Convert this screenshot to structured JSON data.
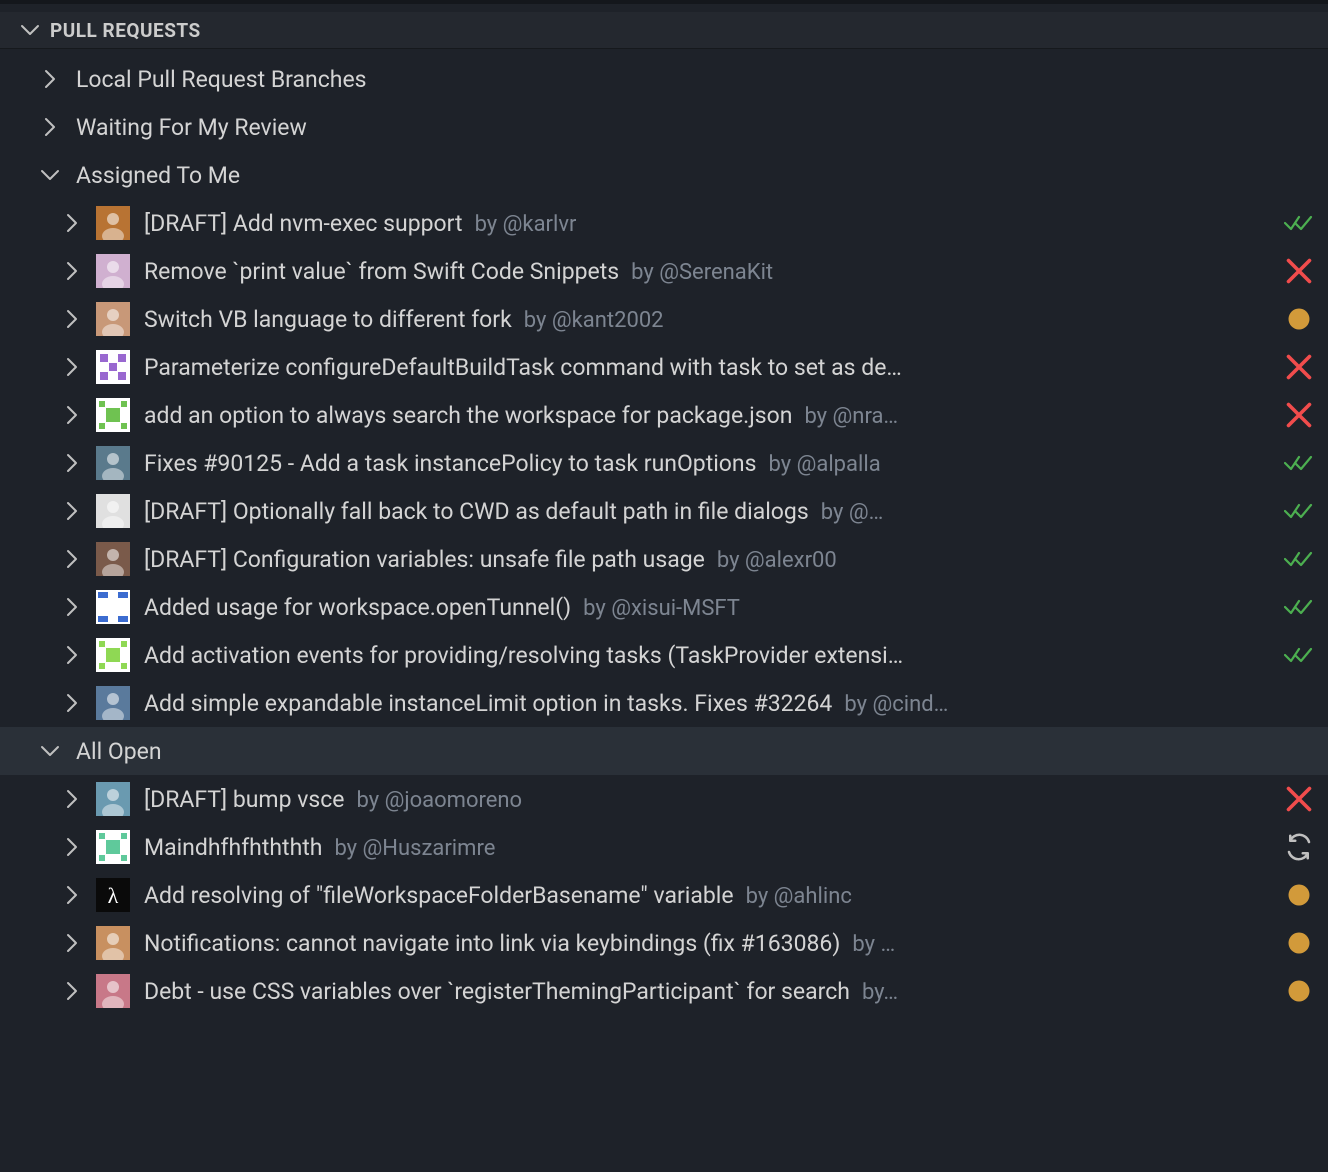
{
  "panel": {
    "title": "PULL REQUESTS"
  },
  "groups": [
    {
      "id": "local",
      "label": "Local Pull Request Branches",
      "expanded": false,
      "items": []
    },
    {
      "id": "waiting",
      "label": "Waiting For My Review",
      "expanded": false,
      "items": []
    },
    {
      "id": "assigned",
      "label": "Assigned To Me",
      "expanded": true,
      "items": [
        {
          "title": "[DRAFT] Add nvm-exec support",
          "author": "by @karlvr",
          "status": "success",
          "avatar": "av1"
        },
        {
          "title": "Remove `print value` from Swift Code Snippets",
          "author": "by @SerenaKit",
          "status": "fail",
          "avatar": "av2"
        },
        {
          "title": "Switch VB language to different fork",
          "author": "by @kant2002",
          "status": "pending",
          "avatar": "av3"
        },
        {
          "title": "Parameterize configureDefaultBuildTask command with task to set as de…",
          "author": "",
          "status": "fail",
          "avatar": "av4"
        },
        {
          "title": "add an option to always search the workspace for package.json",
          "author": "by @nra…",
          "status": "fail",
          "avatar": "av5"
        },
        {
          "title": "Fixes #90125 - Add a task instancePolicy to task runOptions",
          "author": "by @alpalla",
          "status": "success",
          "avatar": "av6"
        },
        {
          "title": "[DRAFT] Optionally fall back to CWD as default path in file dialogs",
          "author": "by @…",
          "status": "success",
          "avatar": "av7"
        },
        {
          "title": "[DRAFT] Configuration variables: unsafe file path usage",
          "author": "by @alexr00",
          "status": "success",
          "avatar": "av8"
        },
        {
          "title": "Added usage for workspace.openTunnel()",
          "author": "by @xisui-MSFT",
          "status": "success",
          "avatar": "av9"
        },
        {
          "title": "Add activation events for providing/resolving tasks (TaskProvider extensi…",
          "author": "",
          "status": "success",
          "avatar": "av10"
        },
        {
          "title": "Add simple expandable instanceLimit option in tasks. Fixes #32264",
          "author": "by @cind…",
          "status": "none",
          "avatar": "av11"
        }
      ]
    },
    {
      "id": "allopen",
      "label": "All Open",
      "expanded": true,
      "selected": true,
      "items": [
        {
          "title": "[DRAFT] bump vsce",
          "author": "by @joaomoreno",
          "status": "fail",
          "avatar": "av12"
        },
        {
          "title": "Maindhfhfhththth",
          "author": "by @Huszarimre",
          "status": "sync",
          "avatar": "av13"
        },
        {
          "title": "Add resolving of \"fileWorkspaceFolderBasename\" variable",
          "author": "by @ahlinc",
          "status": "pending",
          "avatar": "av14"
        },
        {
          "title": "Notifications: cannot navigate into link via keybindings (fix #163086)",
          "author": "by …",
          "status": "pending",
          "avatar": "av15"
        },
        {
          "title": "Debt - use CSS variables over `registerThemingParticipant`  for search",
          "author": "by…",
          "status": "pending",
          "avatar": "av16"
        }
      ]
    }
  ],
  "avatars": {
    "av1": "#b87333",
    "av2": "#d0b0d0",
    "av3": "#c89878",
    "av4": "#9968d0",
    "av5": "#6fc251",
    "av6": "#5a7a8c",
    "av7": "#e0e0e0",
    "av8": "#7a5a4a",
    "av9": "#e0e0e0",
    "av10": "#8fd854",
    "av11": "#5a7a9c",
    "av12": "#6a9ab0",
    "av13": "#5fc99b",
    "av14": "#0a0a0a",
    "av15": "#c89060",
    "av16": "#c87888"
  }
}
